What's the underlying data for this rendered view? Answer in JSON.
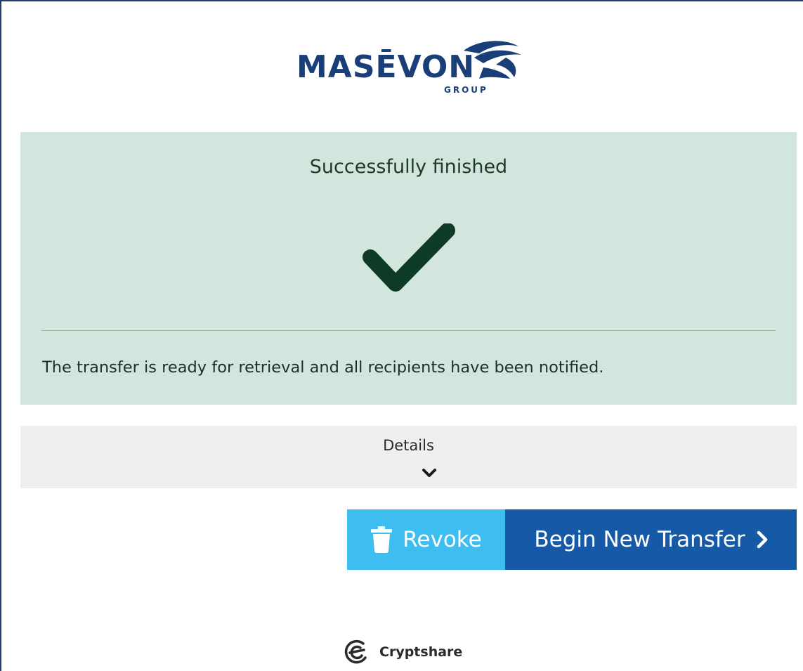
{
  "logo": {
    "name": "MASĒVON",
    "subtitle": "GROUP",
    "color": "#1a3f78"
  },
  "status": {
    "title": "Successfully finished",
    "message": "The transfer is ready for retrieval and all recipients have been notified.",
    "icon": "checkmark-icon",
    "panel_color": "#d2e6dd",
    "check_color": "#0e3b27"
  },
  "details": {
    "label": "Details",
    "icon": "chevron-down-icon"
  },
  "actions": {
    "revoke_label": "Revoke",
    "revoke_icon": "trash-icon",
    "revoke_color": "#3dbdf0",
    "begin_label": "Begin New Transfer",
    "begin_icon": "chevron-right-icon",
    "begin_color": "#1659a6"
  },
  "footer": {
    "brand_name": "Cryptshare",
    "brand_icon": "cryptshare-logo-icon"
  }
}
